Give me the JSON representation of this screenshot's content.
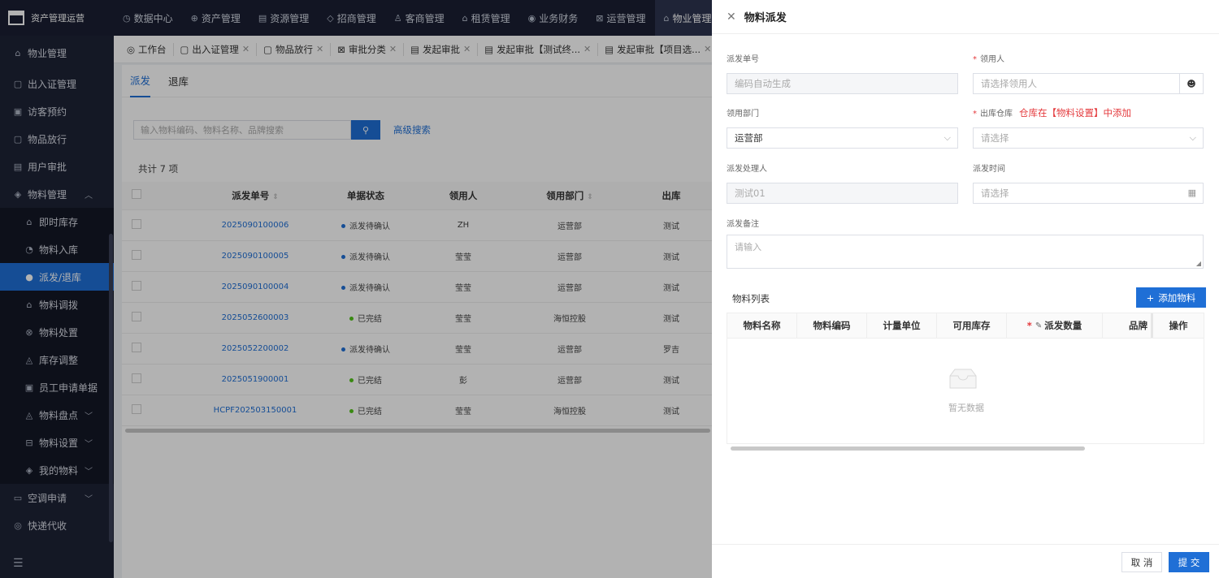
{
  "app": {
    "title": "资产管理运营"
  },
  "topnav": [
    {
      "label": "数据中心",
      "icon": "◷"
    },
    {
      "label": "资产管理",
      "icon": "⊕"
    },
    {
      "label": "资源管理",
      "icon": "▤"
    },
    {
      "label": "招商管理",
      "icon": "◇"
    },
    {
      "label": "客商管理",
      "icon": "♙"
    },
    {
      "label": "租赁管理",
      "icon": "⌂"
    },
    {
      "label": "业务财务",
      "icon": "◉"
    },
    {
      "label": "运营管理",
      "icon": "⊠"
    },
    {
      "label": "物业管理",
      "icon": "⌂",
      "active": true
    }
  ],
  "sidebar": {
    "top": [
      {
        "label": "物业管理",
        "icon": "⌂"
      },
      {
        "label": "出入证管理",
        "icon": "▢"
      },
      {
        "label": "访客预约",
        "icon": "▣"
      },
      {
        "label": "物品放行",
        "icon": "▢"
      },
      {
        "label": "用户审批",
        "icon": "▤"
      },
      {
        "label": "物料管理",
        "icon": "◈",
        "caret": "^"
      }
    ],
    "sub": [
      {
        "label": "即时库存",
        "icon": "⌂"
      },
      {
        "label": "物料入库",
        "icon": "◔"
      },
      {
        "label": "派发/退库",
        "icon": "●",
        "active": true
      },
      {
        "label": "物料调拨",
        "icon": "⌂"
      },
      {
        "label": "物料处置",
        "icon": "⊗"
      },
      {
        "label": "库存调整",
        "icon": "◬"
      },
      {
        "label": "员工申请单据",
        "icon": "▣"
      },
      {
        "label": "物料盘点",
        "icon": "◬",
        "caret": "v"
      },
      {
        "label": "物料设置",
        "icon": "⊟",
        "caret": "v"
      },
      {
        "label": "我的物料",
        "icon": "◈",
        "caret": "v"
      }
    ],
    "bottom": [
      {
        "label": "空调申请",
        "icon": "▭",
        "caret": "v"
      },
      {
        "label": "快递代收",
        "icon": "◎"
      }
    ],
    "menu_icon": "☰"
  },
  "tabs": [
    {
      "label": "工作台",
      "icon": "◎",
      "closable": false
    },
    {
      "label": "出入证管理",
      "icon": "▢"
    },
    {
      "label": "物品放行",
      "icon": "▢"
    },
    {
      "label": "审批分类",
      "icon": "⊠"
    },
    {
      "label": "发起审批",
      "icon": "▤"
    },
    {
      "label": "发起审批【测试终...",
      "icon": "▤"
    },
    {
      "label": "发起审批【项目选...",
      "icon": "▤"
    }
  ],
  "main": {
    "subtabs": [
      "派发",
      "退库"
    ],
    "search_placeholder": "输入物料编码、物料名称、品牌搜索",
    "search_icon": "🔍",
    "advanced": "高级搜索",
    "total": "共计 7 项",
    "columns": [
      "派发单号",
      "单据状态",
      "领用人",
      "领用部门",
      "出库"
    ],
    "rows": [
      {
        "no": "2025090100006",
        "status": "派发待确认",
        "status_color": "#1f6fd6",
        "user": "ZH",
        "dept": "运营部",
        "wh": "测试"
      },
      {
        "no": "2025090100005",
        "status": "派发待确认",
        "status_color": "#1f6fd6",
        "user": "莹莹",
        "dept": "运营部",
        "wh": "测试"
      },
      {
        "no": "2025090100004",
        "status": "派发待确认",
        "status_color": "#1f6fd6",
        "user": "莹莹",
        "dept": "运营部",
        "wh": "测试"
      },
      {
        "no": "2025052600003",
        "status": "已完结",
        "status_color": "#52c41a",
        "user": "莹莹",
        "dept": "海恒控股",
        "wh": "测试"
      },
      {
        "no": "2025052200002",
        "status": "派发待确认",
        "status_color": "#1f6fd6",
        "user": "莹莹",
        "dept": "运营部",
        "wh": "罗吉"
      },
      {
        "no": "2025051900001",
        "status": "已完结",
        "status_color": "#52c41a",
        "user": "彭",
        "dept": "运营部",
        "wh": "测试"
      },
      {
        "no": "HCPF202503150001",
        "status": "已完结",
        "status_color": "#52c41a",
        "user": "莹莹",
        "dept": "海恒控股",
        "wh": "测试"
      }
    ]
  },
  "drawer": {
    "title": "物料派发",
    "fields": {
      "order_no": {
        "label": "派发单号",
        "value": "编码自动生成"
      },
      "receiver": {
        "label": "领用人",
        "placeholder": "请选择领用人"
      },
      "dept": {
        "label": "领用部门",
        "value": "运营部"
      },
      "warehouse": {
        "label": "出库仓库",
        "placeholder": "请选择",
        "hint": "仓库在【物料设置】中添加"
      },
      "handler": {
        "label": "派发处理人",
        "value": "测试01"
      },
      "time": {
        "label": "派发时间",
        "placeholder": "请选择"
      },
      "remark": {
        "label": "派发备注",
        "placeholder": "请输入"
      }
    },
    "material_list": {
      "title": "物料列表",
      "add_button": "添加物料",
      "columns": [
        "物料名称",
        "物料编码",
        "计量单位",
        "可用库存",
        "派发数量",
        "品牌",
        "操作"
      ],
      "empty": "暂无数据"
    },
    "cancel": "取 消",
    "submit": "提 交"
  }
}
